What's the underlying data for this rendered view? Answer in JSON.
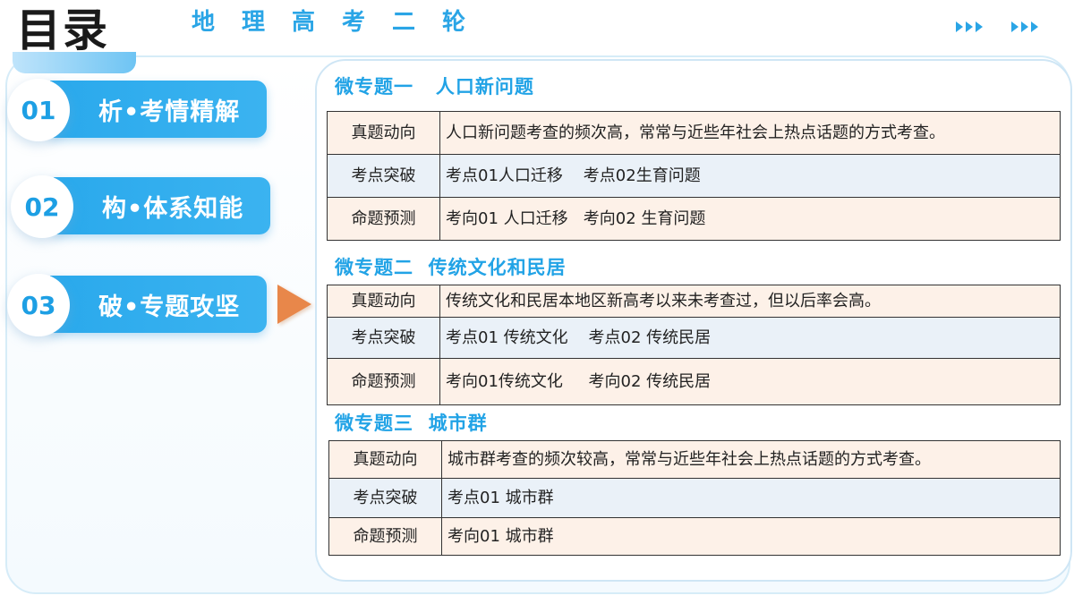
{
  "header": {
    "title": "目录",
    "subtitle": "地理高考二轮"
  },
  "colors": {
    "accent_blue": "#2aa9ec",
    "arrow_orange": "#e8874a",
    "row_peach": "#fdf1e8",
    "row_blue": "#eaf1f8"
  },
  "menu": {
    "items": [
      {
        "number": "01",
        "label": "析•考情精解"
      },
      {
        "number": "02",
        "label": "构•体系知能"
      },
      {
        "number": "03",
        "label": "破•专题攻坚",
        "active": true
      }
    ]
  },
  "sections": [
    {
      "title": "微专题一   人口新问题",
      "rows": [
        {
          "key": "真题动向",
          "value": "人口新问题考查的频次高，常常与近些年社会上热点话题的方式考查。"
        },
        {
          "key": "考点突破",
          "value": "考点01人口迁移    考点02生育问题"
        },
        {
          "key": "命题预测",
          "value": "考向01 人口迁移   考向02 生育问题"
        }
      ]
    },
    {
      "title": "微专题二  传统文化和民居",
      "rows": [
        {
          "key": "真题动向",
          "value": "传统文化和民居本地区新高考以来未考查过，但以后率会高。"
        },
        {
          "key": "考点突破",
          "value": "考点01 传统文化    考点02 传统民居"
        },
        {
          "key": "命题预测",
          "value": "考向01传统文化     考向02 传统民居"
        }
      ]
    },
    {
      "title": "微专题三  城市群",
      "rows": [
        {
          "key": "真题动向",
          "value": "城市群考查的频次较高，常常与近些年社会上热点话题的方式考查。"
        },
        {
          "key": "考点突破",
          "value": "考点01 城市群"
        },
        {
          "key": "命题预测",
          "value": "考向01 城市群"
        }
      ]
    }
  ]
}
